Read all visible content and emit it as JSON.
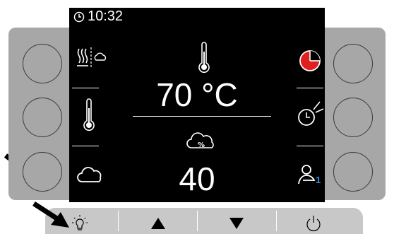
{
  "status": {
    "time": "10:32"
  },
  "display": {
    "temperature": "70 °C",
    "humidity": "40",
    "profile_badge": "1"
  },
  "icons": {
    "left": [
      "steam-icon",
      "thermometer-icon",
      "cloud-icon"
    ],
    "right": [
      "timer-red-icon",
      "timer-hand-icon",
      "user-profile-icon"
    ],
    "center": [
      "thermometer-icon",
      "humidity-cloud-icon"
    ],
    "bottom": [
      "light-bulb-icon",
      "arrow-up-icon",
      "arrow-down-icon",
      "power-icon"
    ]
  },
  "colors": {
    "screen_bg": "#000000",
    "bezel": "#a7a7a7",
    "timer_accent": "#e02020",
    "badge": "#2f8ee8"
  }
}
